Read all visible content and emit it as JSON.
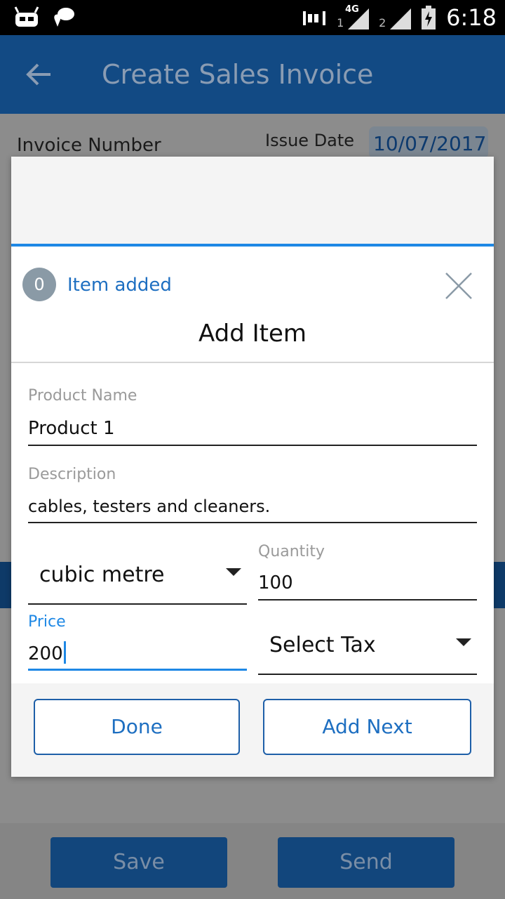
{
  "status_bar": {
    "time": "6:18",
    "sim1_label": "1",
    "sim1_network": "4G",
    "sim2_label": "2"
  },
  "app_bar": {
    "title": "Create Sales Invoice"
  },
  "background_form": {
    "invoice_number_label": "Invoice Number",
    "issue_date_label": "Issue Date",
    "issue_date_value": "10/07/2017",
    "save_label": "Save",
    "send_label": "Send"
  },
  "dialog": {
    "items_added_count": "0",
    "items_added_text": "Item added",
    "title": "Add Item",
    "product_name": {
      "label": "Product Name",
      "value": "Product 1"
    },
    "description": {
      "label": "Description",
      "value": "cables, testers and cleaners."
    },
    "unit_select": {
      "value": "cubic metre"
    },
    "quantity": {
      "label": "Quantity",
      "value": "100"
    },
    "price": {
      "label": "Price",
      "value": "200"
    },
    "tax_select": {
      "value": "Select Tax"
    },
    "done_label": "Done",
    "add_next_label": "Add Next"
  },
  "colors": {
    "app_bar": "#124a84",
    "accent": "#1e88e5",
    "link_text": "#1e6fc1"
  }
}
